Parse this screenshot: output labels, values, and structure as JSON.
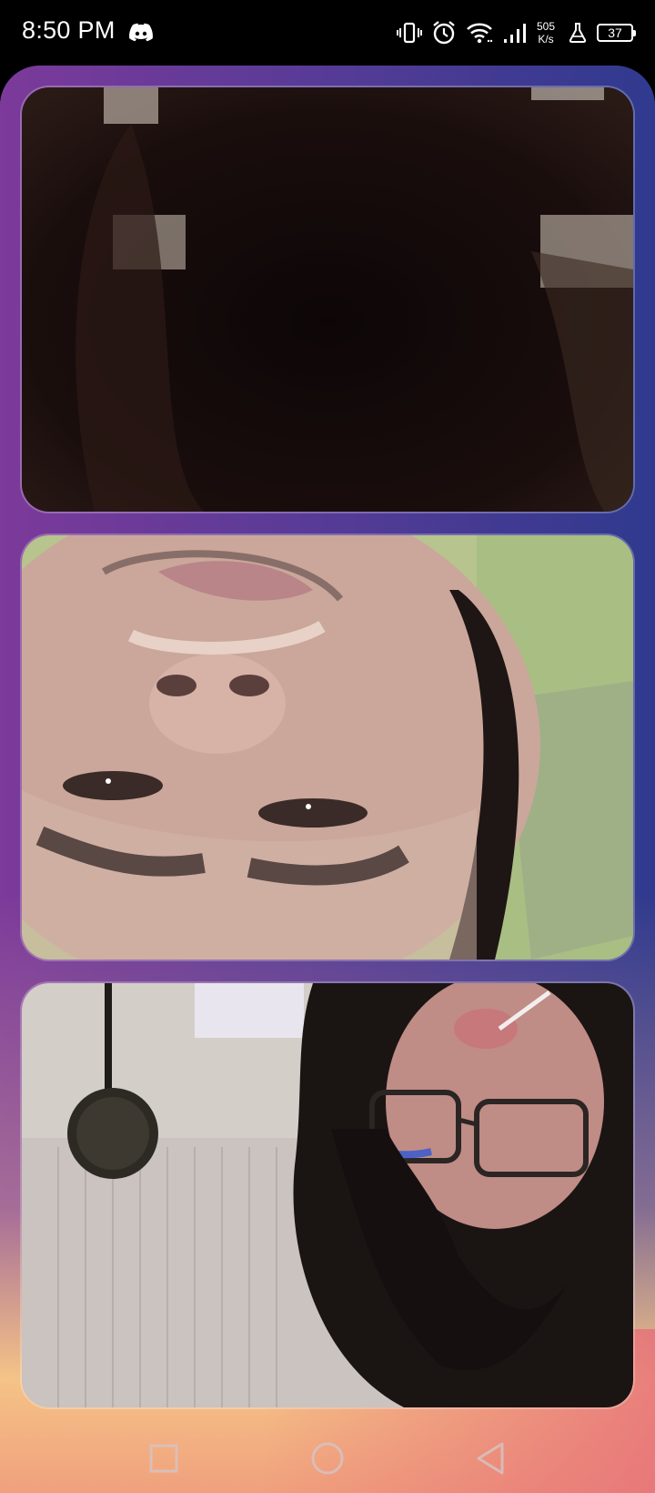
{
  "status_bar": {
    "time": "8:50 PM",
    "notification_icons": [
      "discord-icon"
    ],
    "system_icons": [
      "vibrate-icon",
      "alarm-icon",
      "wifi-icon",
      "signal-icon",
      "lab-icon"
    ],
    "net_speed_value": "505",
    "net_speed_unit": "K/s",
    "battery_level": "37"
  },
  "video_tiles": [
    {
      "id": "participant-1"
    },
    {
      "id": "participant-2"
    },
    {
      "id": "participant-3"
    }
  ],
  "nav_bar": {
    "buttons": [
      "recents-button",
      "home-button",
      "back-button"
    ]
  },
  "colors": {
    "gradient_top_left": "#7c3a9a",
    "gradient_top_right": "#2f3a8e",
    "gradient_bottom": "#f5c88c",
    "gradient_bottom_right": "#e8707a"
  }
}
